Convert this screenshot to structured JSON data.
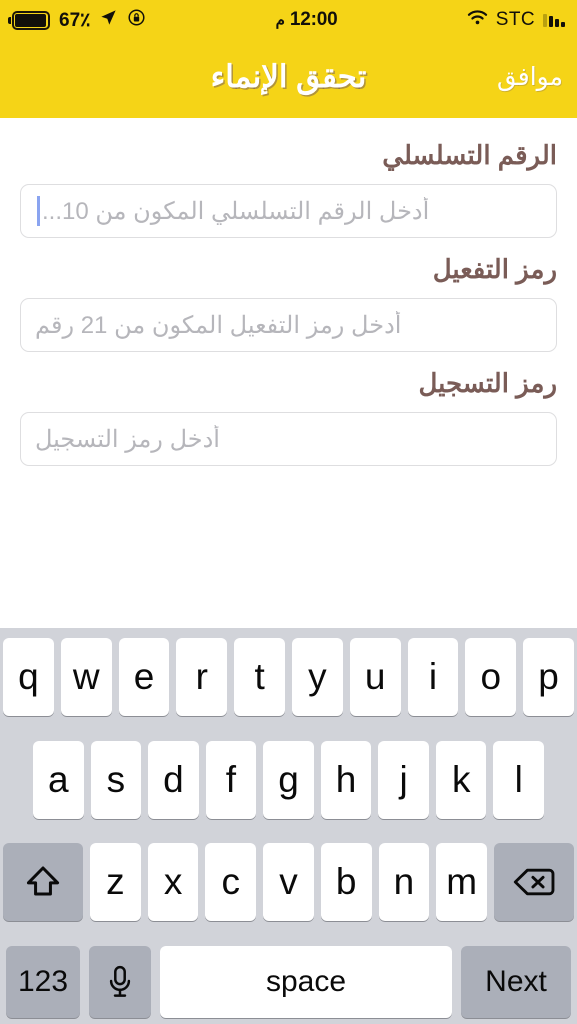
{
  "status_bar": {
    "battery_percent": "67٪",
    "location_icon": "location-arrow-icon",
    "rotation_lock_icon": "rotation-lock-icon",
    "time": "12:00",
    "am_pm": "م",
    "wifi_icon": "wifi-icon",
    "carrier": "STC",
    "signal_icon": "signal-bars-icon"
  },
  "nav_bar": {
    "title": "تحقق الإنماء",
    "action_label": "موافق"
  },
  "form": {
    "fields": [
      {
        "label": "الرقم التسلسلي",
        "placeholder": "أدخل الرقم التسلسلي المكون من 10...",
        "value": "",
        "focused": true
      },
      {
        "label": "رمز التفعيل",
        "placeholder": "أدخل رمز التفعيل المكون من 21 رقم",
        "value": "",
        "focused": false
      },
      {
        "label": "رمز التسجيل",
        "placeholder": "أدخل رمز التسجيل",
        "value": "",
        "focused": false
      }
    ]
  },
  "keyboard": {
    "row1": [
      "q",
      "w",
      "e",
      "r",
      "t",
      "y",
      "u",
      "i",
      "o",
      "p"
    ],
    "row2": [
      "a",
      "s",
      "d",
      "f",
      "g",
      "h",
      "j",
      "k",
      "l"
    ],
    "row3_letters": [
      "z",
      "x",
      "c",
      "v",
      "b",
      "n",
      "m"
    ],
    "shift_icon": "shift-icon",
    "backspace_icon": "backspace-icon",
    "numbers_label": "123",
    "mic_icon": "microphone-icon",
    "space_label": "space",
    "return_label": "Next"
  },
  "colors": {
    "brand_yellow": "#F5D417",
    "label_brown": "#7A5C57",
    "placeholder_gray": "#B6B6BB",
    "keyboard_bg": "#D1D3D9",
    "key_white": "#FFFFFF",
    "key_dark": "#ABAFB9",
    "caret_blue": "#8AA4F0"
  }
}
